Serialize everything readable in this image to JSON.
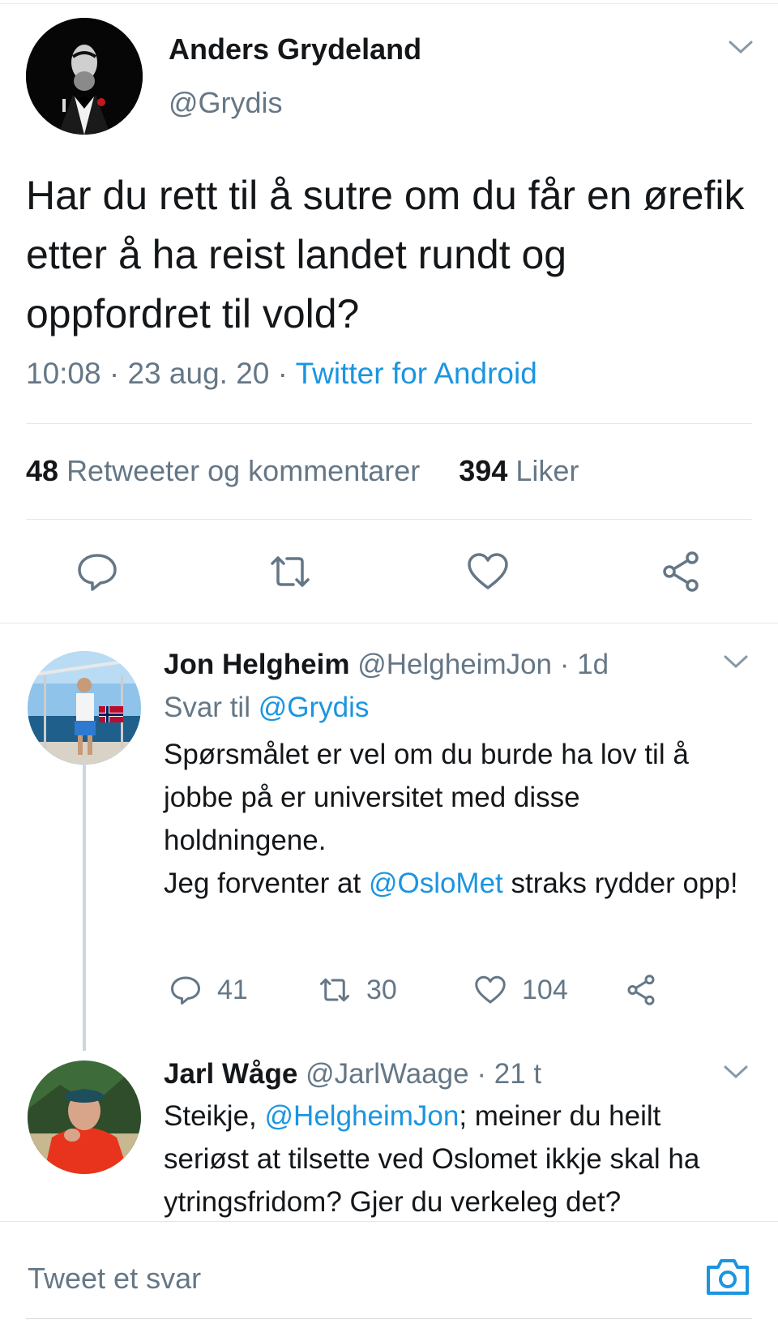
{
  "main_tweet": {
    "author_name": "Anders Grydeland",
    "author_handle": "@Grydis",
    "text": "Har du rett til å sutre om du får en ørefik etter å ha reist landet rundt og oppfordret til vold?",
    "time": "10:08",
    "date": "23 aug. 20",
    "source": "Twitter for Android",
    "retweets_count": "48",
    "retweets_label": "Retweeter og kommentarer",
    "likes_count": "394",
    "likes_label": "Liker",
    "actions": [
      "comment-icon",
      "retweet-icon",
      "heart-icon",
      "share-icon"
    ]
  },
  "replies": [
    {
      "author_name": "Jon Helgheim",
      "author_handle": "@HelgheimJon",
      "age": "1d",
      "reply_to_label": "Svar til",
      "reply_to_handle": "@Grydis",
      "text_1": "Spørsmålet er vel om du burde ha lov til å jobbe på er universitet med disse holdningene.",
      "text_2_before": "Jeg forventer at",
      "text_2_mention": "@OsloMet",
      "text_2_after": "straks rydder opp!",
      "comments": "41",
      "retweets": "30",
      "likes": "104"
    },
    {
      "author_name": "Jarl Wåge",
      "author_handle": "@JarlWaage",
      "age": "21 t",
      "text_before": "Steikje,",
      "text_mention": "@HelgheimJon",
      "text_after": "; meiner du heilt seriøst at tilsette ved Oslomet ikkje skal ha ytringsfridom? Gjer du verkeleg det?"
    }
  ],
  "composer": {
    "placeholder": "Tweet et svar",
    "icon": "camera-icon"
  },
  "colors": {
    "link": "#1b95e0",
    "secondary": "#657786",
    "divider": "#e1e8ed"
  }
}
